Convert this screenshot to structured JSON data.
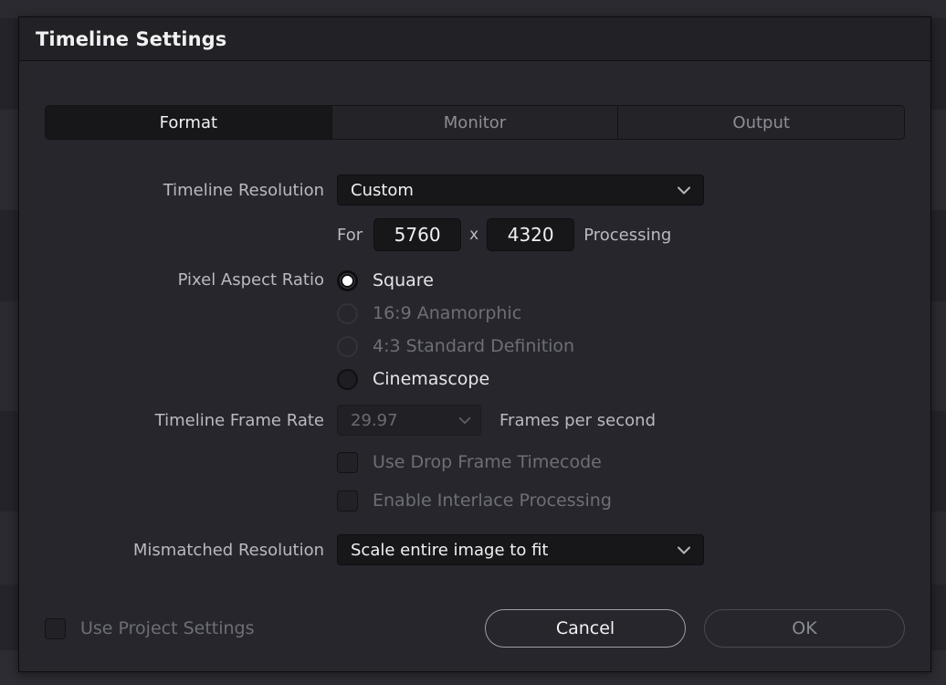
{
  "window": {
    "title": "Timeline Settings"
  },
  "tabs": [
    {
      "label": "Format",
      "active": true
    },
    {
      "label": "Monitor",
      "active": false
    },
    {
      "label": "Output",
      "active": false
    }
  ],
  "format": {
    "resolution": {
      "label": "Timeline Resolution",
      "value": "Custom",
      "chevron_icon": "chevron-down-icon"
    },
    "custom_size": {
      "prefix": "For",
      "width": "5760",
      "separator": "x",
      "height": "4320",
      "suffix": "Processing"
    },
    "pixel_aspect_ratio": {
      "label": "Pixel Aspect Ratio",
      "options": [
        {
          "label": "Square",
          "selected": true,
          "disabled": false
        },
        {
          "label": "16:9 Anamorphic",
          "selected": false,
          "disabled": true
        },
        {
          "label": "4:3 Standard Definition",
          "selected": false,
          "disabled": true
        },
        {
          "label": "Cinemascope",
          "selected": false,
          "disabled": false
        }
      ]
    },
    "frame_rate": {
      "label": "Timeline Frame Rate",
      "value": "29.97",
      "suffix": "Frames per second",
      "disabled": true
    },
    "checkboxes": [
      {
        "label": "Use Drop Frame Timecode",
        "checked": false,
        "disabled": true
      },
      {
        "label": "Enable Interlace Processing",
        "checked": false,
        "disabled": true
      }
    ],
    "mismatched_resolution": {
      "label": "Mismatched Resolution",
      "value": "Scale entire image to fit"
    }
  },
  "footer": {
    "use_project_settings": {
      "label": "Use Project Settings",
      "checked": false,
      "disabled": true
    },
    "cancel_label": "Cancel",
    "ok_label": "OK"
  },
  "colors": {
    "dialog_bg": "#26262c",
    "titlebar_bg": "#212126",
    "field_bg": "#17171a",
    "text_primary": "#f0f0f2",
    "text_secondary": "#b9b9c0",
    "text_disabled": "#6e6e77",
    "accent_border": "#9d9da6"
  }
}
